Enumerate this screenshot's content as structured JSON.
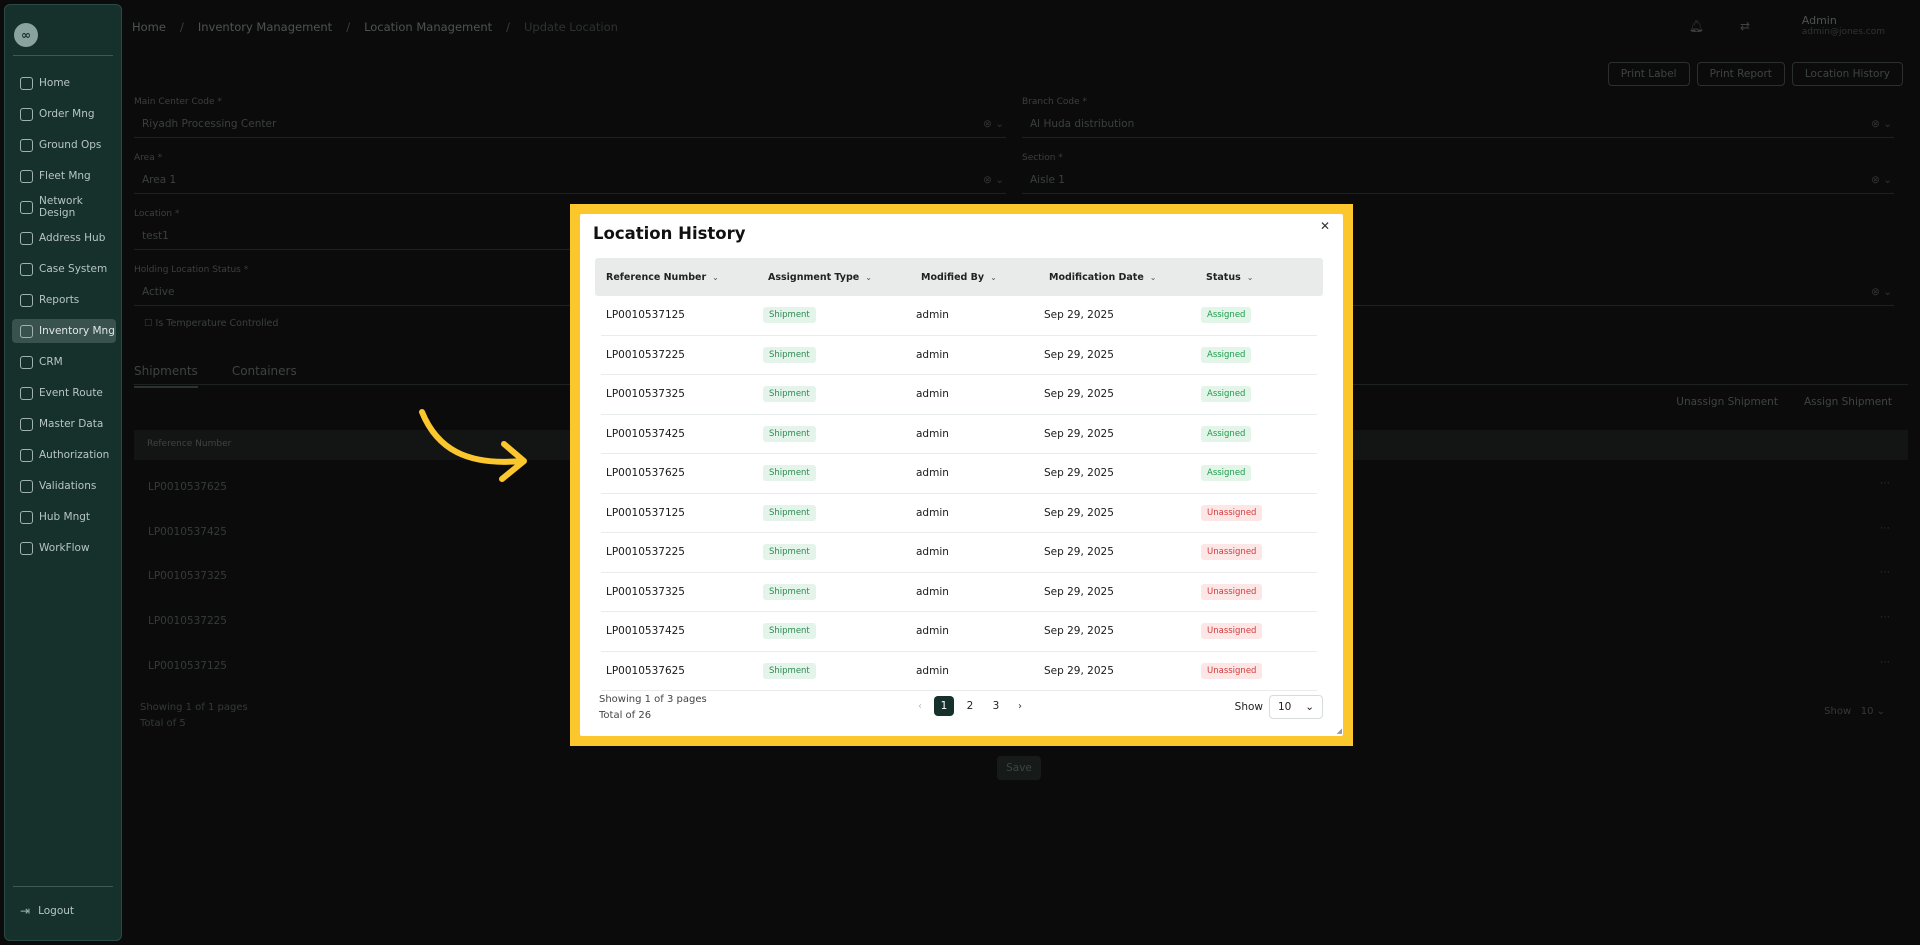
{
  "sidebar": {
    "logo": "∞",
    "items": [
      {
        "label": "Home"
      },
      {
        "label": "Order Mng"
      },
      {
        "label": "Ground Ops"
      },
      {
        "label": "Fleet Mng"
      },
      {
        "label": "Network Design"
      },
      {
        "label": "Address Hub"
      },
      {
        "label": "Case System"
      },
      {
        "label": "Reports"
      },
      {
        "label": "Inventory Mng"
      },
      {
        "label": "CRM"
      },
      {
        "label": "Event Route"
      },
      {
        "label": "Master Data"
      },
      {
        "label": "Authorization"
      },
      {
        "label": "Validations"
      },
      {
        "label": "Hub Mngt"
      },
      {
        "label": "WorkFlow"
      }
    ],
    "logout": "Logout"
  },
  "background": {
    "breadcrumb": [
      "Home",
      "Inventory Management",
      "Location Management",
      "Update Location"
    ],
    "user": {
      "name": "Admin",
      "email": "admin@jones.com"
    },
    "buttons": [
      "Print Label",
      "Print Report",
      "Location History"
    ],
    "fields": {
      "main_center_label": "Main Center Code *",
      "main_center_value": "Riyadh Processing Center",
      "branch_label": "Branch Code *",
      "branch_value": "Al Huda distribution",
      "area_label": "Area *",
      "area_value": "Area 1",
      "section_label": "Section *",
      "section_value": "Aisle 1",
      "location_label": "Location *",
      "location_value": "test1",
      "status_label": "Holding Location Status *",
      "status_value": "Active",
      "temp_label": "Is Temperature Controlled"
    },
    "tabs": [
      "Shipments",
      "Containers"
    ],
    "side_buttons": [
      "Unassign Shipment",
      "Assign Shipment"
    ],
    "table_header": "Reference Number",
    "rows": [
      "LP0010537625",
      "LP0010537425",
      "LP0010537325",
      "LP0010537225",
      "LP0010537125"
    ],
    "page_info": "Showing 1 of 1 pages",
    "total_info": "Total of 5",
    "show_label": "Show",
    "show_value": "10",
    "save": "Save"
  },
  "modal": {
    "title": "Location History",
    "columns": [
      "Reference Number",
      "Assignment Type",
      "Modified By",
      "Modification Date",
      "Status"
    ],
    "rows": [
      {
        "ref": "LP0010537125",
        "type": "Shipment",
        "by": "admin",
        "date": "Sep 29, 2025",
        "status": "Assigned"
      },
      {
        "ref": "LP0010537225",
        "type": "Shipment",
        "by": "admin",
        "date": "Sep 29, 2025",
        "status": "Assigned"
      },
      {
        "ref": "LP0010537325",
        "type": "Shipment",
        "by": "admin",
        "date": "Sep 29, 2025",
        "status": "Assigned"
      },
      {
        "ref": "LP0010537425",
        "type": "Shipment",
        "by": "admin",
        "date": "Sep 29, 2025",
        "status": "Assigned"
      },
      {
        "ref": "LP0010537625",
        "type": "Shipment",
        "by": "admin",
        "date": "Sep 29, 2025",
        "status": "Assigned"
      },
      {
        "ref": "LP0010537125",
        "type": "Shipment",
        "by": "admin",
        "date": "Sep 29, 2025",
        "status": "Unassigned"
      },
      {
        "ref": "LP0010537225",
        "type": "Shipment",
        "by": "admin",
        "date": "Sep 29, 2025",
        "status": "Unassigned"
      },
      {
        "ref": "LP0010537325",
        "type": "Shipment",
        "by": "admin",
        "date": "Sep 29, 2025",
        "status": "Unassigned"
      },
      {
        "ref": "LP0010537425",
        "type": "Shipment",
        "by": "admin",
        "date": "Sep 29, 2025",
        "status": "Unassigned"
      },
      {
        "ref": "LP0010537625",
        "type": "Shipment",
        "by": "admin",
        "date": "Sep 29, 2025",
        "status": "Unassigned"
      }
    ],
    "page_info": "Showing 1 of 3 pages",
    "total_info": "Total of 26",
    "pages": [
      "1",
      "2",
      "3"
    ],
    "current_page": "1",
    "show_label": "Show",
    "show_value": "10"
  },
  "colors": {
    "highlight_frame": "#fcc72d",
    "sidebar_bg": "#16302c",
    "assigned": "#1f9c4c",
    "unassigned": "#d43c3c"
  }
}
